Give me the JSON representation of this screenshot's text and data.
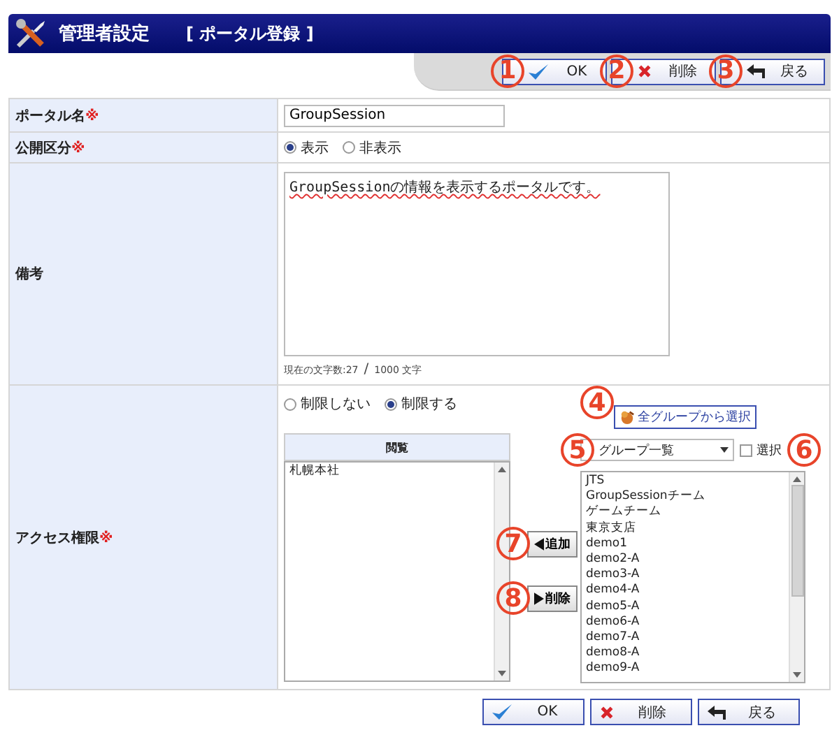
{
  "header": {
    "title": "管理者設定",
    "subtitle": "[ ポータル登録 ]"
  },
  "top_buttons": [
    {
      "kind": "ok",
      "label": "OK",
      "callout": "1"
    },
    {
      "kind": "delete",
      "label": "削除",
      "callout": "2"
    },
    {
      "kind": "back",
      "label": "戻る",
      "callout": "3"
    }
  ],
  "form": {
    "portal_name": {
      "label": "ポータル名",
      "required_mark": "※",
      "value": "GroupSession"
    },
    "visibility": {
      "label": "公開区分",
      "required_mark": "※",
      "options": [
        {
          "label": "表示",
          "selected": true
        },
        {
          "label": "非表示",
          "selected": false
        }
      ]
    },
    "notes": {
      "label": "備考",
      "value": "GroupSessionの情報を表示するポータルです。",
      "counter": "現在の文字数:27",
      "separator": "/",
      "limit": "1000 文字"
    },
    "access": {
      "label": "アクセス権限",
      "required_mark": "※",
      "options": [
        {
          "label": "制限しない",
          "selected": false
        },
        {
          "label": "制限する",
          "selected": true
        }
      ],
      "viewers": {
        "header": "閲覧",
        "items": [
          "札幌本社"
        ]
      },
      "add_button": {
        "label": "追加",
        "callout": "7"
      },
      "remove_button": {
        "label": "削除",
        "callout": "8"
      },
      "all_groups_button": {
        "label": "全グループから選択",
        "callout": "4"
      },
      "group_select": {
        "value": "グループ一覧",
        "callout": "5"
      },
      "select_checkbox": {
        "label": "選択",
        "checked": false,
        "callout": "6"
      },
      "groups": [
        "JTS",
        "GroupSessionチーム",
        "ゲームチーム",
        "東京支店",
        "demo1",
        "demo2-A",
        "demo3-A",
        "demo4-A",
        "demo5-A",
        "demo6-A",
        "demo7-A",
        "demo8-A",
        "demo9-A"
      ]
    }
  },
  "bottom_buttons": [
    {
      "kind": "ok",
      "label": "OK"
    },
    {
      "kind": "delete",
      "label": "削除"
    },
    {
      "kind": "back",
      "label": "戻る"
    }
  ]
}
